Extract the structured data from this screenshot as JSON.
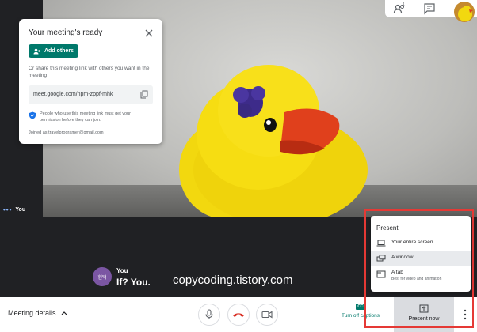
{
  "top_bar": {
    "you_label": "You"
  },
  "meeting_card": {
    "title": "Your meeting's ready",
    "add_others_label": "Add others",
    "share_text": "Or share this meeting link with others you want in the meeting",
    "meeting_link": "meet.google.com/npm-zppf-mhk",
    "notice": "People who use this meeting link must get your permission before they can join.",
    "joined_as": "Joined as travelprogramer@gmail.com"
  },
  "self_tile": {
    "label": "You"
  },
  "caption": {
    "avatar_text": "현택",
    "speaker": "You",
    "text": "If? You."
  },
  "watermark": "copycoding.tistory.com",
  "bottom_bar": {
    "meeting_details_label": "Meeting details",
    "captions_badge": "CC",
    "captions_label": "Turn off captions",
    "present_label": "Present now",
    "end_call_color": "#d93025"
  },
  "present_menu": {
    "title": "Present",
    "items": [
      {
        "label": "Your entire screen",
        "sub": "",
        "icon": "laptop-icon"
      },
      {
        "label": "A window",
        "sub": "",
        "icon": "window-icon"
      },
      {
        "label": "A tab",
        "sub": "Best for video and animation",
        "icon": "tab-icon"
      }
    ]
  }
}
